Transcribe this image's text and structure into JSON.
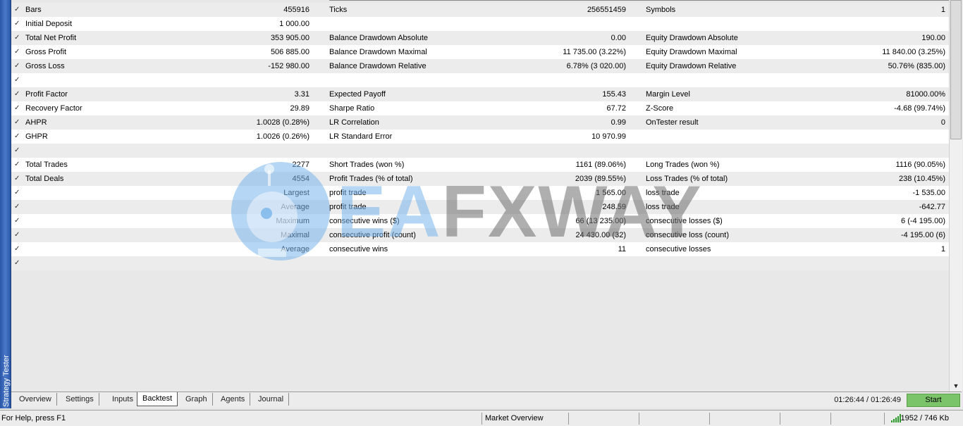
{
  "window": {
    "side_title": "Strategy Tester"
  },
  "report": {
    "rows": [
      {
        "c1": "Bars",
        "v1": "455916",
        "c2": "Ticks",
        "v2": "256551459",
        "c3": "Symbols",
        "v3": "1"
      },
      {
        "c1": "Initial Deposit",
        "v1": "1 000.00",
        "c2": "",
        "v2": "",
        "c3": "",
        "v3": ""
      },
      {
        "c1": "Total Net Profit",
        "v1": "353 905.00",
        "c2": "Balance Drawdown Absolute",
        "v2": "0.00",
        "c3": "Equity Drawdown Absolute",
        "v3": "190.00"
      },
      {
        "c1": "Gross Profit",
        "v1": "506 885.00",
        "c2": "Balance Drawdown Maximal",
        "v2": "11 735.00 (3.22%)",
        "c3": "Equity Drawdown Maximal",
        "v3": "11 840.00 (3.25%)"
      },
      {
        "c1": "Gross Loss",
        "v1": "-152 980.00",
        "c2": "Balance Drawdown Relative",
        "v2": "6.78% (3 020.00)",
        "c3": "Equity Drawdown Relative",
        "v3": "50.76% (835.00)"
      },
      {
        "c1": "",
        "v1": "",
        "c2": "",
        "v2": "",
        "c3": "",
        "v3": ""
      },
      {
        "c1": "Profit Factor",
        "v1": "3.31",
        "c2": "Expected Payoff",
        "v2": "155.43",
        "c3": "Margin Level",
        "v3": "81000.00%"
      },
      {
        "c1": "Recovery Factor",
        "v1": "29.89",
        "c2": "Sharpe Ratio",
        "v2": "67.72",
        "c3": "Z-Score",
        "v3": "-4.68 (99.74%)"
      },
      {
        "c1": "AHPR",
        "v1": "1.0028 (0.28%)",
        "c2": "LR Correlation",
        "v2": "0.99",
        "c3": "OnTester result",
        "v3": "0"
      },
      {
        "c1": "GHPR",
        "v1": "1.0026 (0.26%)",
        "c2": "LR Standard Error",
        "v2": "10 970.99",
        "c3": "",
        "v3": ""
      },
      {
        "c1": "",
        "v1": "",
        "c2": "",
        "v2": "",
        "c3": "",
        "v3": ""
      },
      {
        "c1": "Total Trades",
        "v1": "2277",
        "c2": "Short Trades (won %)",
        "v2": "1161 (89.06%)",
        "c3": "Long Trades (won %)",
        "v3": "1116 (90.05%)"
      },
      {
        "c1": "Total Deals",
        "v1": "4554",
        "c2": "Profit Trades (% of total)",
        "v2": "2039 (89.55%)",
        "c3": "Loss Trades (% of total)",
        "v3": "238 (10.45%)"
      },
      {
        "c1": "",
        "v1": "Largest",
        "c2": "profit trade",
        "v2": "1 565.00",
        "c3": "loss trade",
        "v3": "-1 535.00"
      },
      {
        "c1": "",
        "v1": "Average",
        "c2": "profit trade",
        "v2": "248.59",
        "c3": "loss trade",
        "v3": "-642.77"
      },
      {
        "c1": "",
        "v1": "Maximum",
        "c2": "consecutive wins ($)",
        "v2": "66 (13 235.00)",
        "c3": "consecutive losses ($)",
        "v3": "6 (-4 195.00)"
      },
      {
        "c1": "",
        "v1": "Maximal",
        "c2": "consecutive profit (count)",
        "v2": "24 430.00 (32)",
        "c3": "consecutive loss (count)",
        "v3": "-4 195.00 (6)"
      },
      {
        "c1": "",
        "v1": "Average",
        "c2": "consecutive wins",
        "v2": "11",
        "c3": "consecutive losses",
        "v3": "1"
      },
      {
        "c1": "",
        "v1": "",
        "c2": "",
        "v2": "",
        "c3": "",
        "v3": ""
      }
    ]
  },
  "tabs": [
    "Overview",
    "Settings",
    "Inputs",
    "Backtest",
    "Graph",
    "Agents",
    "Journal"
  ],
  "active_tab": "Backtest",
  "elapsed": "01:26:44 / 01:26:49",
  "start_label": "Start",
  "status_bar": {
    "help": "For Help, press F1",
    "market": "Market Overview",
    "memory": "1952 / 746 Kb"
  },
  "watermark": {
    "blue_part": "EA",
    "gray_part": "FXWAY"
  },
  "colors": {
    "accent_blue": "#2a56a8",
    "start_green": "#7cc46a",
    "watermark_blue": "#78b4eb"
  },
  "icons": {
    "check": "check-icon",
    "signal": "signal-bars-icon",
    "scroll_down": "chevron-down-icon"
  }
}
